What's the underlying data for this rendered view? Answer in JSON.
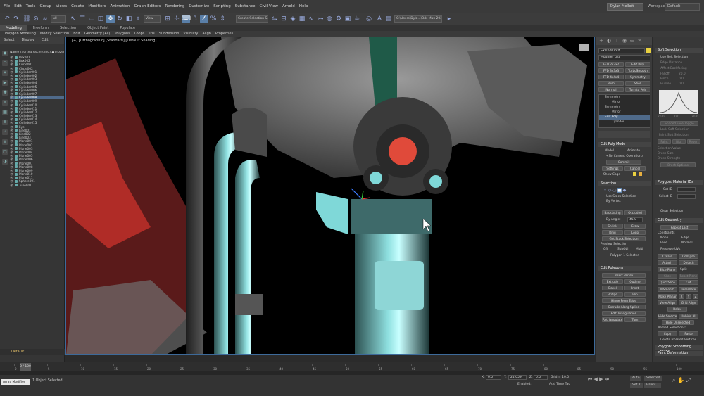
{
  "menu": [
    "File",
    "Edit",
    "Tools",
    "Group",
    "Views",
    "Create",
    "Modifiers",
    "Animation",
    "Graph Editors",
    "Rendering",
    "Customize",
    "Scripting",
    "Substance",
    "Civil View",
    "Arnold",
    "Help"
  ],
  "user": "Dylan Mellott",
  "workspace_label": "Workspaces:",
  "workspace_value": "Default",
  "toolbar": {
    "filter_value": "All",
    "view_value": "View",
    "selection_set": "Create Selection Set",
    "path": "C:\\Users\\Dyla...\\3ds Max 2024"
  },
  "ribbon_tabs": [
    "Modeling",
    "Freeform",
    "Selection",
    "Object Paint",
    "Populate"
  ],
  "ribbon_items": [
    "Polygon Modeling",
    "Modify Selection",
    "Edit",
    "Geometry (All)",
    "Polygons",
    "Loops",
    "Tris",
    "Subdivision",
    "Visibility",
    "Align",
    "Properties"
  ],
  "scene": {
    "tabs": [
      "Select",
      "Display",
      "Edit"
    ],
    "header": "Name (Sorted Ascending) ▲ Frozen",
    "items": [
      "Box001",
      "Box002",
      "Circle001",
      "Circle002",
      "Cylinder001",
      "Cylinder002",
      "Cylinder003",
      "Cylinder004",
      "Cylinder005",
      "Cylinder006",
      "Cylinder007",
      "Cylinder008",
      "Cylinder009",
      "Cylinder010",
      "Cylinder011",
      "Cylinder012",
      "Cylinder013",
      "Cylinder014",
      "Cylinder015",
      "Eye",
      "Line001",
      "Line002",
      "Line003",
      "Plane001",
      "Plane002",
      "Plane003",
      "Plane004",
      "Plane005",
      "Plane006",
      "Plane007",
      "Plane008",
      "Plane009",
      "Plane010",
      "Plane011",
      "Sphere001",
      "Tube001"
    ],
    "selected_index": 11,
    "footer": "Default"
  },
  "viewport": {
    "label": "[+] [Orthographic] [Standard] [Default Shading]"
  },
  "command_panel": {
    "object_name": "Cylinder009",
    "modifier_list": "Modifier List",
    "modifier_buttons": [
      "FFD 2x2x2",
      "Edit Poly",
      "FFD 3x3x3",
      "TurboSmooth",
      "FFD 4x4x4",
      "Symmetry",
      "Push",
      "Shell",
      "Normal",
      "Turn to Poly"
    ],
    "stack": [
      "Symmetry",
      "Mirror",
      "Symmetry",
      "Mirror",
      "Edit Poly",
      "Cylinder"
    ],
    "sections": {
      "edit_poly_mode": "Edit Poly Mode",
      "selection": "Selection",
      "edit_polygons": "Edit Polygons"
    },
    "edit_poly_mode": {
      "model": "Model",
      "animate": "Animate",
      "no_op": "<No Current Operation>",
      "commit": "Commit",
      "settings": "Settings",
      "cancel": "Cancel",
      "show_cage": "Show Cage"
    },
    "selection_labels": {
      "use_stack": "Use Stack Selection",
      "by_vertex": "By Vertex",
      "backface": "Backfacing",
      "occluded": "Occluded",
      "by_angle": "By Angle:",
      "angle": "45.0",
      "shrink": "Shrink",
      "grow": "Grow",
      "ring": "Ring",
      "loop": "Loop",
      "get_stack": "Get Stack Selection",
      "preview": "Preview Selection",
      "off": "Off",
      "subobj": "SubObj",
      "multi": "Multi",
      "status": "Polygon 1 Selected"
    },
    "edit_polygons": [
      "Insert Vertex",
      "Extrude",
      "Outline",
      "Bevel",
      "Inset",
      "Bridge",
      "Flip",
      "Hinge From Edge",
      "Extrude Along Spline",
      "Edit Triangulation",
      "Retriangulate",
      "Turn"
    ]
  },
  "soft_panel": {
    "title": "Soft Selection",
    "use_soft": "Use Soft Selection",
    "edge_distance": "Edge Distance",
    "affect_backfacing": "Affect Backfacing",
    "falloff": "Falloff",
    "falloff_v": "20.0",
    "pinch": "Pinch",
    "pinch_v": "0.0",
    "bubble": "Bubble",
    "bubble_v": "0.0",
    "curve_axis": [
      "20.0",
      "0.0",
      "20.0"
    ],
    "shaded_face": "Shaded Face Toggle",
    "lock_soft": "Lock Soft Selection",
    "paint_soft": "Paint Soft Selection",
    "paint": "Paint",
    "blur": "Blur",
    "revert": "Revert",
    "selection_value": "Selection Value",
    "brush_size": "Brush Size",
    "brush_strength": "Brush Strength",
    "brush_options": "Brush Options",
    "material_ids": "Polygon: Material IDs",
    "set_id": "Set ID",
    "select_id": "Select ID",
    "clear_selection": "Clear Selection",
    "edit_geometry": "Edit Geometry",
    "repeat_last": "Repeat Last",
    "constraints": "Constraints",
    "none": "None",
    "edge": "Edge",
    "face": "Face",
    "normal": "Normal",
    "preserve_uvs": "Preserve UVs",
    "create": "Create",
    "collapse": "Collapse",
    "attach": "Attach",
    "detach": "Detach",
    "slice_plane": "Slice Plane",
    "split": "Split",
    "slice": "Slice",
    "reset_plane": "Reset Plane",
    "quickslice": "QuickSlice",
    "cut": "Cut",
    "msmooth": "MSmooth",
    "tessellate": "Tessellate",
    "make_planar": "Make Planar",
    "x": "X",
    "y": "Y",
    "z": "Z",
    "view_align": "View Align",
    "grid_align": "Grid Align",
    "relax": "Relax",
    "hide_selected": "Hide Selected",
    "unhide_all": "Unhide All",
    "hide_unselected": "Hide Unselected",
    "named_selections": "Named Selections:",
    "copy": "Copy",
    "paste": "Paste",
    "delete_isolated": "Delete Isolated Vertices",
    "smoothing_groups": "Polygon: Smoothing Groups",
    "paint_deformation": "Paint Deformation"
  },
  "timeline": {
    "frame": "0 / 100",
    "ticks": [
      "0",
      "5",
      "10",
      "15",
      "20",
      "25",
      "30",
      "35",
      "40",
      "45",
      "50",
      "55",
      "60",
      "65",
      "70",
      "75",
      "80",
      "85",
      "90",
      "95",
      "100"
    ]
  },
  "status": {
    "script": "Array Modifier",
    "selected": "1 Object Selected",
    "x": "0.0",
    "y": "24.059",
    "z": "0.0",
    "grid": "Grid = 10.0",
    "enabled": "Enabled:",
    "add_time_tag": "Add Time Tag",
    "auto": "Auto",
    "selected_mode": "Selected",
    "set_key": "Set K.",
    "filters": "Filters..."
  },
  "colors": {
    "accent": "#5a7fa8",
    "cyan": "#7fd8d8",
    "red_marker": "#e04a3a",
    "selected_row": "#4f6a8a"
  }
}
